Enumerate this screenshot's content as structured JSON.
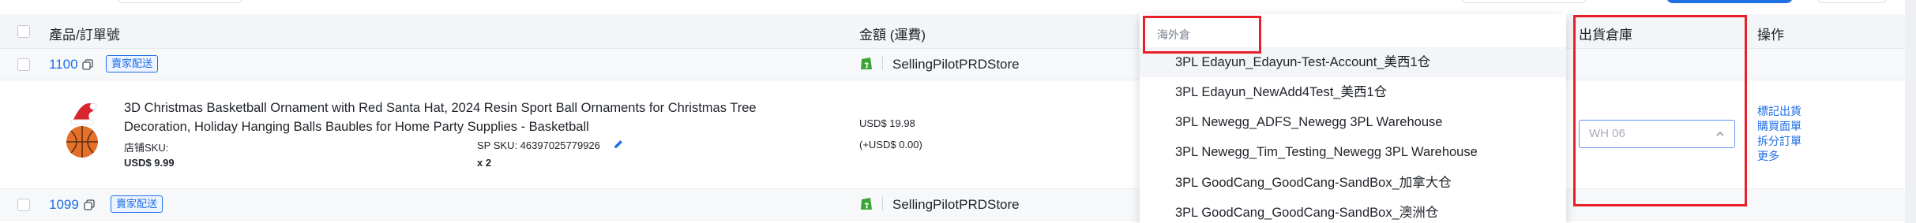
{
  "header": {
    "col_product": "產品/訂單號",
    "col_amount": "金額 (運費)",
    "col_warehouse": "出貨倉庫",
    "col_action": "操作"
  },
  "order_1100": {
    "order_no": "1100",
    "badge": "賣家配送",
    "store": "SellingPilotPRDStore"
  },
  "product": {
    "title": "3D Christmas Basketball Ornament with Red Santa Hat, 2024 Resin Sport Ball Ornaments for Christmas Tree Decoration, Holiday Hanging Balls Baubles for Home Party Supplies - Basketball",
    "shop_sku_label": "店铺SKU:",
    "sp_sku": "SP SKU: 46397025779926",
    "unit_price": "USD$ 9.99",
    "quantity": "x 2",
    "amount": "USD$ 19.98",
    "shipping": "(+USD$ 0.00)"
  },
  "order_1099": {
    "order_no": "1099",
    "badge": "賣家配送",
    "store": "SellingPilotPRDStore"
  },
  "dropdown": {
    "group_label": "海外倉",
    "options": [
      "3PL Edayun_Edayun-Test-Account_美西1仓",
      "3PL Edayun_NewAdd4Test_美西1仓",
      "3PL Newegg_ADFS_Newegg 3PL Warehouse",
      "3PL Newegg_Tim_Testing_Newegg 3PL Warehouse",
      "3PL GoodCang_GoodCang-SandBox_加拿大仓",
      "3PL GoodCang_GoodCang-SandBox_澳洲仓"
    ]
  },
  "warehouse_select": {
    "placeholder": "WH 06"
  },
  "actions": [
    "標記出貨",
    "購買面單",
    "拆分訂單",
    "更多"
  ],
  "colors": {
    "accent": "#1f6fe5",
    "highlight_box": "#e8202a",
    "header_bg": "#f3f5f8",
    "store_icon": "#3aa535"
  }
}
